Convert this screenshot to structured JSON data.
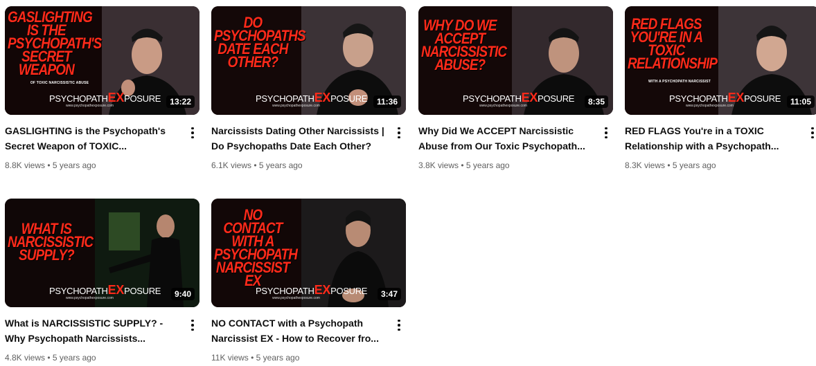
{
  "brand": {
    "prefix": "PSYCHOPATH",
    "ex": "EX",
    "suffix": "POSURE",
    "url": "www.psychopathexposure.com"
  },
  "videos": [
    {
      "thumb_text": "GASLIGHTING IS THE PSYCHOPATH'S SECRET WEAPON",
      "thumb_sub": "OF TOXIC NARCISSISTIC ABUSE",
      "duration": "13:22",
      "title": "GASLIGHTING is the Psychopath's Secret Weapon of TOXIC...",
      "stats": "8.8K views • 5 years ago"
    },
    {
      "thumb_text": "DO PSYCHOPATHS DATE EACH OTHER?",
      "thumb_sub": "",
      "duration": "11:36",
      "title": "Narcissists Dating Other Narcissists | Do Psychopaths Date Each Other?",
      "stats": "6.1K views • 5 years ago"
    },
    {
      "thumb_text": "WHY DO WE ACCEPT NARCISSISTIC ABUSE?",
      "thumb_sub": "",
      "duration": "8:35",
      "title": "Why Did We ACCEPT Narcissistic Abuse from Our Toxic Psychopath...",
      "stats": "3.8K views • 5 years ago"
    },
    {
      "thumb_text": "RED FLAGS YOU'RE IN A TOXIC RELATIONSHIP",
      "thumb_sub": "WITH A PSYCHOPATH NARCISSIST",
      "duration": "11:05",
      "title": "RED FLAGS You're in a TOXIC Relationship with a Psychopath...",
      "stats": "8.3K views • 5 years ago"
    },
    {
      "thumb_text": "WHAT IS NARCISSISTIC SUPPLY?",
      "thumb_sub": "",
      "duration": "9:40",
      "title": "What is NARCISSISTIC SUPPLY? - Why Psychopath Narcissists...",
      "stats": "4.8K views • 5 years ago"
    },
    {
      "thumb_text": "NO CONTACT WITH A PSYCHOPATH NARCISSIST EX",
      "thumb_sub": "",
      "duration": "3:47",
      "title": "NO CONTACT with a Psychopath Narcissist EX - How to Recover fro...",
      "stats": "11K views • 5 years ago"
    }
  ],
  "colors": {
    "accent": "#ff2a1a",
    "text": "#0f0f0f",
    "secondary": "#606060"
  },
  "icons": {
    "more": "kebab-vertical-icon"
  }
}
